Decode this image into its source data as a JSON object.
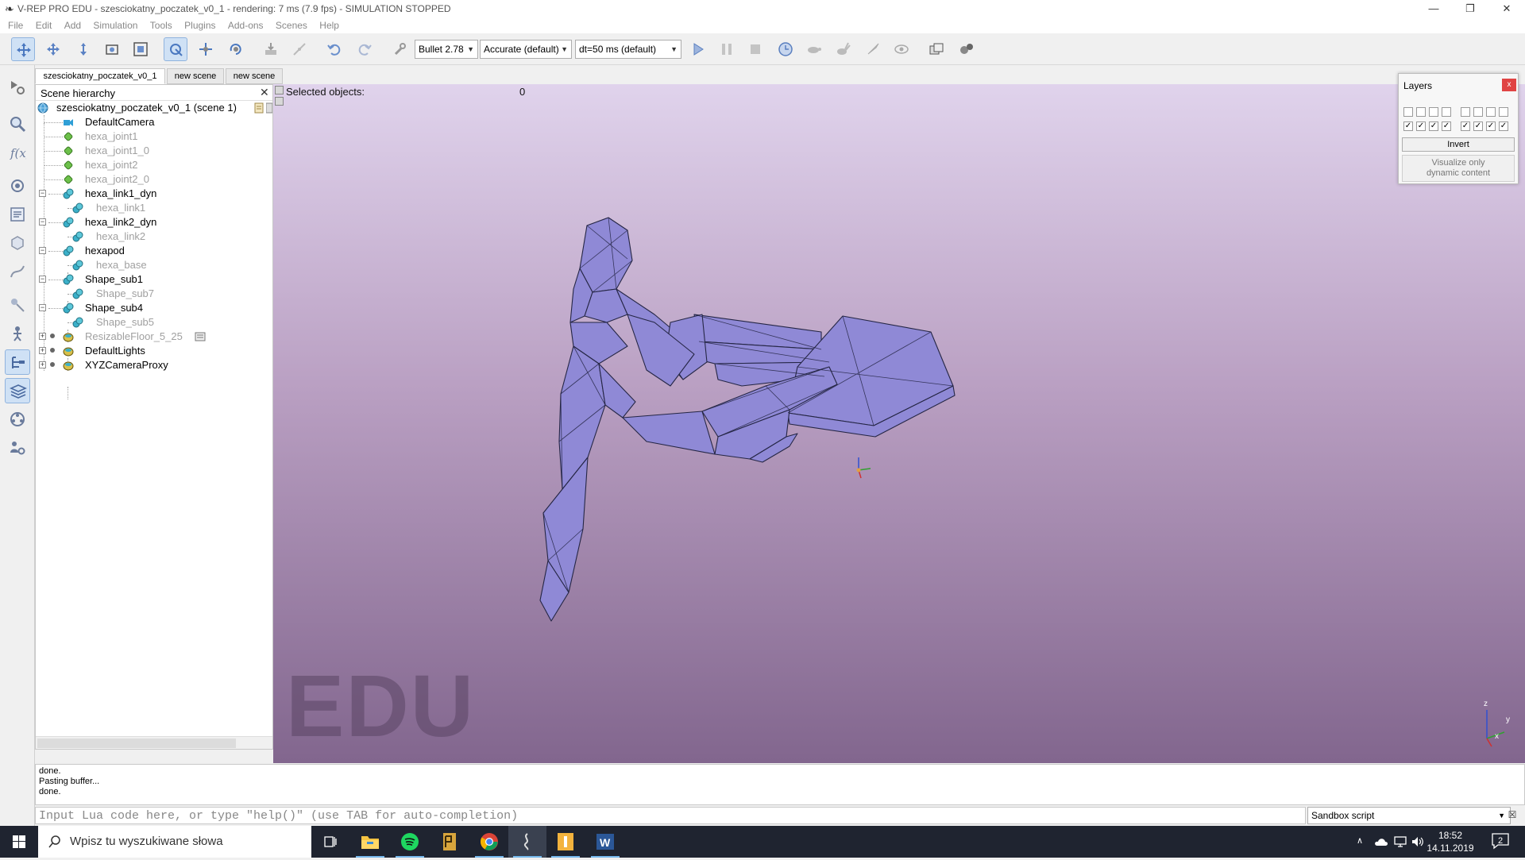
{
  "window": {
    "title": "V-REP PRO EDU - szesciokatny_poczatek_v0_1 - rendering: 7 ms (7.9 fps) - SIMULATION STOPPED"
  },
  "menu": {
    "items": [
      "File",
      "Edit",
      "Add",
      "Simulation",
      "Tools",
      "Plugins",
      "Add-ons",
      "Scenes",
      "Help"
    ]
  },
  "toolbar": {
    "engine": "Bullet 2.78",
    "accuracy": "Accurate (default)",
    "timestep": "dt=50 ms (default)"
  },
  "scene_tabs": [
    "szesciokatny_poczatek_v0_1",
    "new scene",
    "new scene"
  ],
  "hierarchy": {
    "title": "Scene hierarchy",
    "root": "szesciokatny_poczatek_v0_1 (scene 1)",
    "items": [
      {
        "label": "DefaultCamera"
      },
      {
        "label": "hexa_joint1"
      },
      {
        "label": "hexa_joint1_0"
      },
      {
        "label": "hexa_joint2"
      },
      {
        "label": "hexa_joint2_0"
      },
      {
        "label": "hexa_link1_dyn"
      },
      {
        "label": "hexa_link1"
      },
      {
        "label": "hexa_link2_dyn"
      },
      {
        "label": "hexa_link2"
      },
      {
        "label": "hexapod"
      },
      {
        "label": "hexa_base"
      },
      {
        "label": "Shape_sub1"
      },
      {
        "label": "Shape_sub7"
      },
      {
        "label": "Shape_sub4"
      },
      {
        "label": "Shape_sub5"
      },
      {
        "label": "ResizableFloor_5_25"
      },
      {
        "label": "DefaultLights"
      },
      {
        "label": "XYZCameraProxy"
      }
    ]
  },
  "viewport": {
    "selected_label": "Selected objects:",
    "selected_count": "0",
    "watermark": "EDU",
    "axis": {
      "z": "z",
      "y": "y",
      "x": "x"
    }
  },
  "layers": {
    "title": "Layers",
    "close": "x",
    "invert_label": "Invert",
    "visualize_line1": "Visualize only",
    "visualize_line2": "dynamic content"
  },
  "console": {
    "lines": [
      "done.",
      "Pasting buffer...",
      "done."
    ],
    "placeholder": "Input Lua code here, or type \"help()\" (use TAB for auto-completion)",
    "script_select": "Sandbox script"
  },
  "taskbar": {
    "search_text": "Wpisz tu wyszukiwane słowa",
    "time": "18:52",
    "date": "14.11.2019",
    "notifications": "2"
  },
  "colors": {
    "accent": "#0078d7",
    "viewport_top": "#e0d3ec",
    "viewport_bottom": "#82668e",
    "model_fill": "#8f89d6",
    "taskbar_bg": "#1f2430"
  }
}
